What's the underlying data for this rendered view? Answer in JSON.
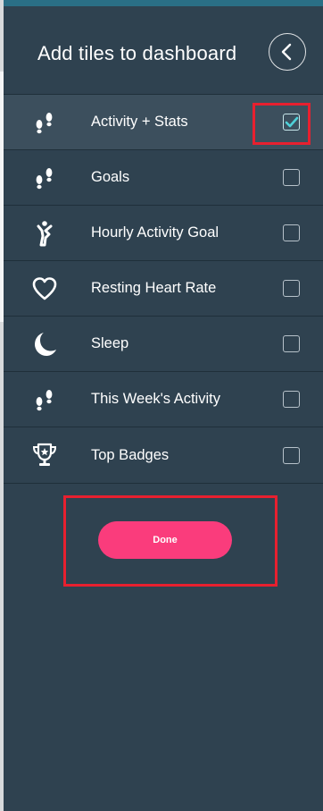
{
  "header": {
    "title": "Add tiles to dashboard",
    "back_icon": "chevron-left-icon"
  },
  "tiles": [
    {
      "label": "Activity + Stats",
      "icon": "footsteps-icon",
      "checked": true
    },
    {
      "label": "Goals",
      "icon": "footsteps-icon",
      "checked": false
    },
    {
      "label": "Hourly Activity Goal",
      "icon": "standing-person-icon",
      "checked": false
    },
    {
      "label": "Resting Heart Rate",
      "icon": "heart-icon",
      "checked": false
    },
    {
      "label": "Sleep",
      "icon": "moon-icon",
      "checked": false
    },
    {
      "label": "This Week's Activity",
      "icon": "footsteps-icon",
      "checked": false
    },
    {
      "label": "Top Badges",
      "icon": "trophy-icon",
      "checked": false
    }
  ],
  "done_button": {
    "label": "Done"
  },
  "colors": {
    "background": "#2f4250",
    "selected_row": "#3c4f5d",
    "accent_pink": "#fa3c7c",
    "check_teal": "#4fd1d9",
    "highlight_red": "#e8202f",
    "top_strip": "#2a6f86"
  }
}
